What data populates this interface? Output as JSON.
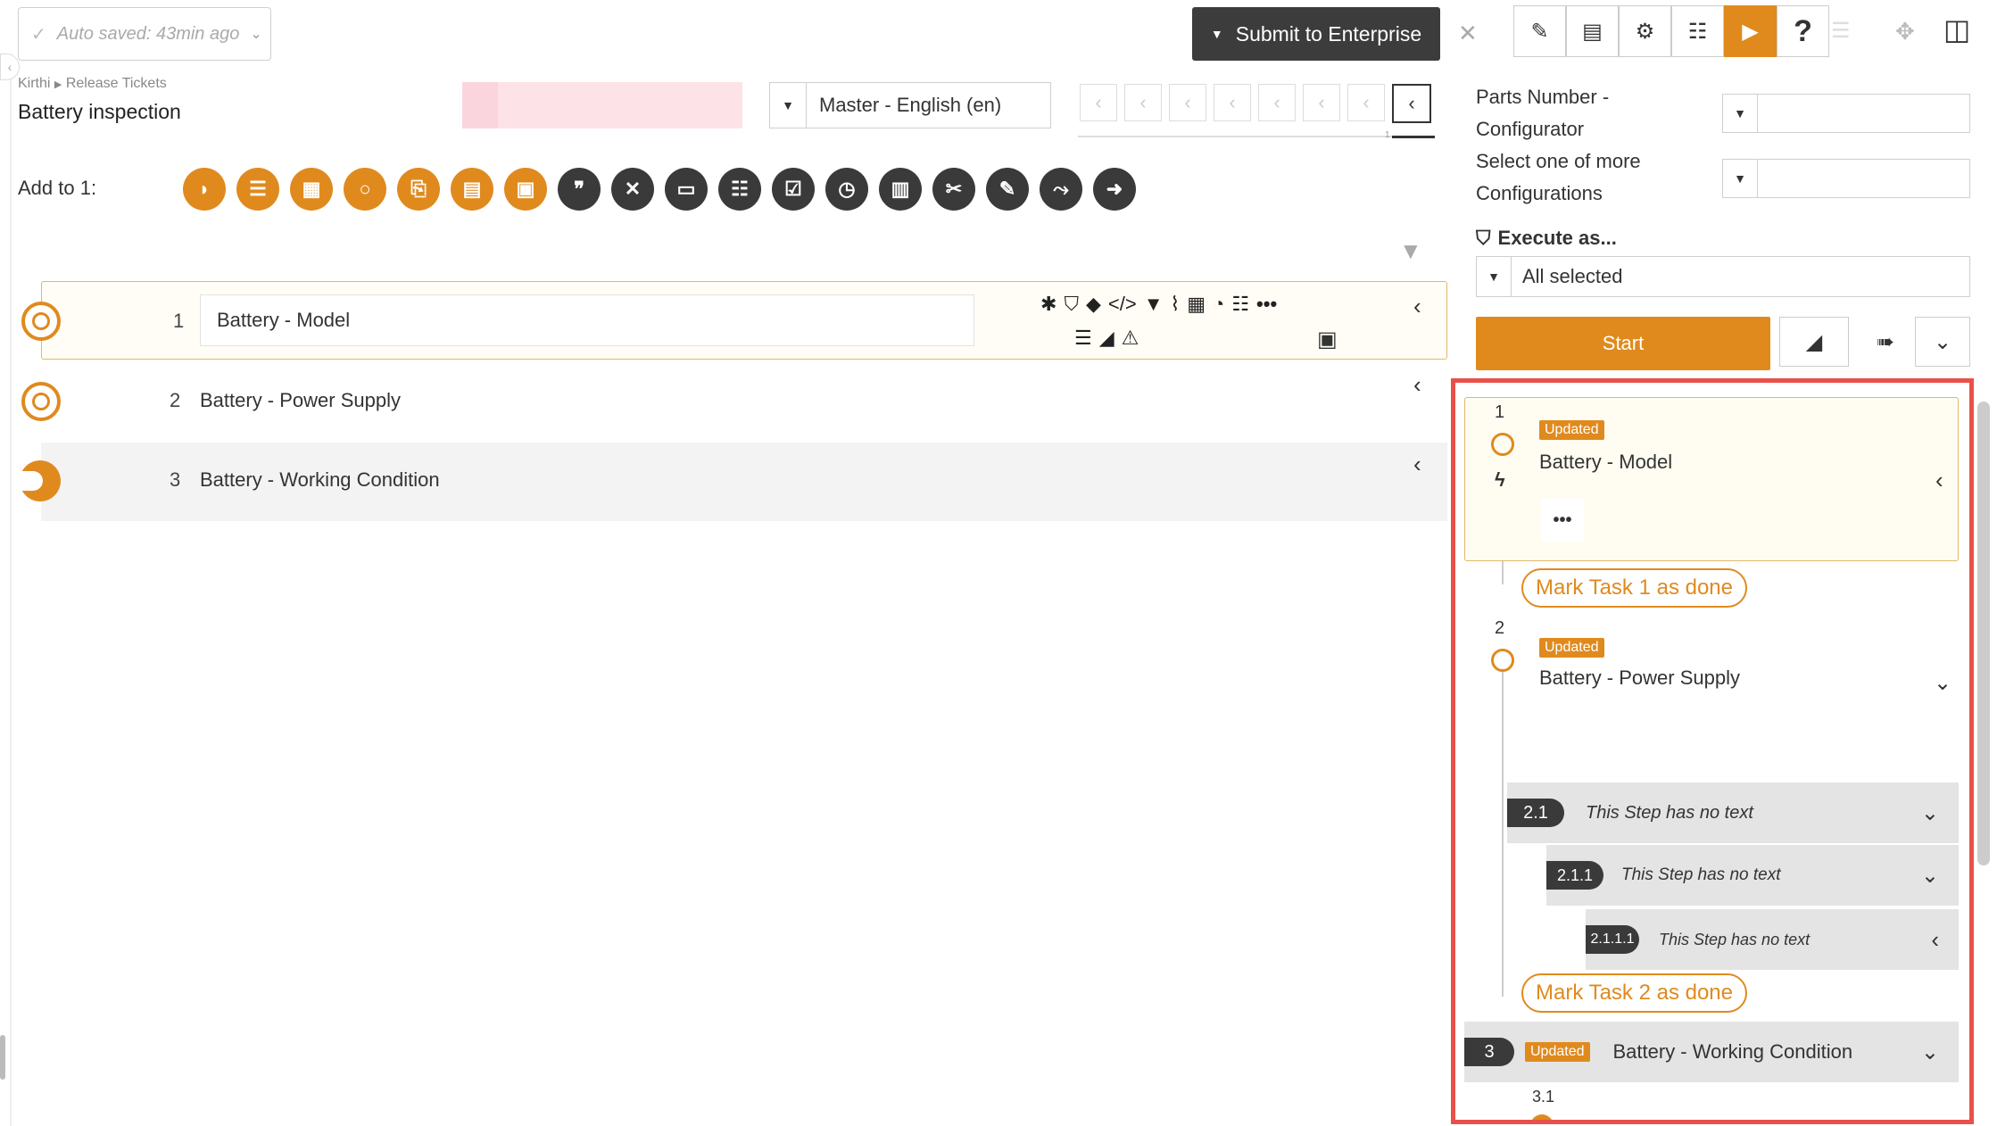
{
  "header": {
    "autosave": "Auto saved: 43min ago",
    "submit_label": "Submit to Enterprise",
    "breadcrumb": [
      "Kirthi",
      "Release Tickets"
    ],
    "doc_title": "Battery inspection",
    "language": "Master - English (en)",
    "nav_marker": "1"
  },
  "toolbar": {
    "add_label": "Add to 1:",
    "orange_icons": [
      "pie-half-icon",
      "list-icon",
      "table-icon",
      "circle-icon",
      "paperclip-icon",
      "clipboard-icon",
      "film-icon"
    ],
    "dark_icons": [
      "quote-icon",
      "tools-x-icon",
      "credit-card-icon",
      "checklist-icon",
      "checkbox-icon",
      "clock-icon",
      "calculator-icon",
      "wrench-screwdriver-icon",
      "edit-icon",
      "share-icon",
      "arrow-right-icon"
    ]
  },
  "tasks": [
    {
      "num": "1",
      "name": "Battery - Model",
      "selected": true
    },
    {
      "num": "2",
      "name": "Battery - Power Supply",
      "selected": false
    },
    {
      "num": "3",
      "name": "Battery - Working Condition",
      "selected": false
    }
  ],
  "task_props_icons": [
    "asterisk-icon",
    "shield-icon",
    "tags-icon",
    "code-icon",
    "filter-icon",
    "paperclip-icon",
    "grid-icon",
    "stopwatch-icon",
    "list-grid-icon",
    "more-icon",
    "list-check-icon",
    "road-icon",
    "warning-icon",
    "id-card-icon"
  ],
  "right": {
    "toolbar_icons": [
      "pencil-icon",
      "clipboard-check-icon",
      "gear-icon",
      "checklist-window-icon",
      "play-icon",
      "help-icon",
      "list-icon",
      "move-icon",
      "add-column-icon"
    ],
    "parts_label": "Parts Number - Configurator",
    "config_label": "Select one of more Configurations",
    "execute_label": "Execute as...",
    "execute_value": "All selected",
    "start_label": "Start",
    "preview": {
      "task1": {
        "num": "1",
        "badge": "Updated",
        "name": "Battery - Model",
        "done": "Mark Task 1 as done"
      },
      "task2": {
        "num": "2",
        "badge": "Updated",
        "name": "Battery - Power Supply",
        "done": "Mark Task 2 as done",
        "steps": [
          {
            "num": "2.1",
            "text": "This Step has no text"
          },
          {
            "num": "2.1.1",
            "text": "This Step has no text"
          },
          {
            "num": "2.1.1.1",
            "text": "This Step has no text"
          }
        ]
      },
      "task3": {
        "num": "3",
        "badge": "Updated",
        "name": "Battery - Working Condition",
        "sub": "3.1"
      }
    }
  },
  "colors": {
    "accent": "#e08a1e",
    "dark": "#3a3a3a",
    "highlight_frame": "#e8514a"
  }
}
